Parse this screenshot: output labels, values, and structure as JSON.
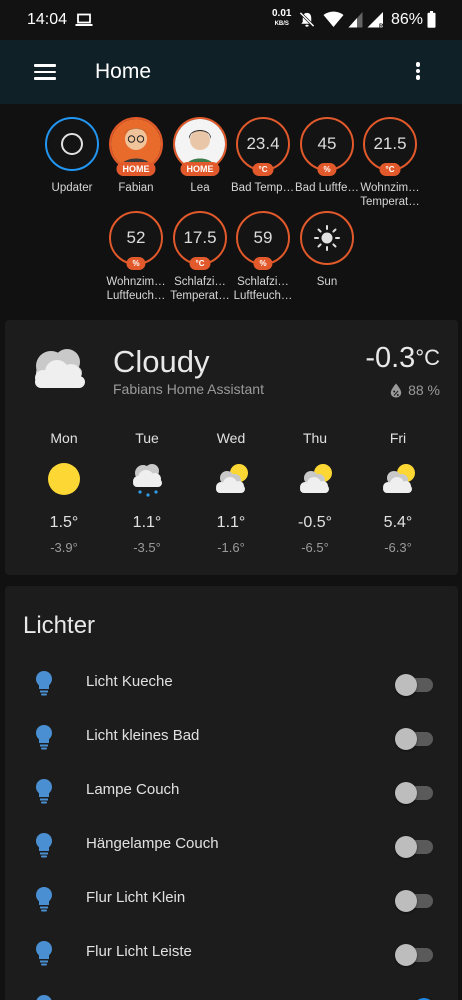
{
  "status_bar": {
    "time": "14:04",
    "net_speed": "0.01",
    "net_unit": "KB/S",
    "battery": "86%"
  },
  "app_bar": {
    "title": "Home",
    "menu_icon": "hamburger-menu-icon",
    "overflow_icon": "more-vert-icon"
  },
  "badges": [
    {
      "label": "Updater",
      "type": "icon",
      "icon": "circle-outline-icon",
      "color": "#2196f3"
    },
    {
      "label": "Fabian",
      "type": "person",
      "tag": "HOME"
    },
    {
      "label": "Lea",
      "type": "person",
      "tag": "HOME"
    },
    {
      "label": "Bad Temperat…",
      "type": "value",
      "value": "23.4",
      "unit": "°C"
    },
    {
      "label": "Bad Luftfeuch…",
      "type": "value",
      "value": "45",
      "unit": "%"
    },
    {
      "label": "Wohnzim… Temperat…",
      "type": "value",
      "value": "21.5",
      "unit": "°C"
    },
    {
      "label": "Wohnzim… Luftfeuch…",
      "type": "value",
      "value": "52",
      "unit": "%"
    },
    {
      "label": "Schlafzi… Temperat…",
      "type": "value",
      "value": "17.5",
      "unit": "°C"
    },
    {
      "label": "Schlafzi… Luftfeuch…",
      "type": "value",
      "value": "59",
      "unit": "%"
    },
    {
      "label": "Sun",
      "type": "icon",
      "icon": "sun-icon"
    }
  ],
  "weather": {
    "condition": "Cloudy",
    "source": "Fabians Home Assistant",
    "temperature": "-0.3",
    "temp_unit": "°C",
    "humidity": "88 %",
    "forecast": [
      {
        "day": "Mon",
        "icon": "sunny-icon",
        "high": "1.5°",
        "low": "-3.9°"
      },
      {
        "day": "Tue",
        "icon": "snowy-icon",
        "high": "1.1°",
        "low": "-3.5°"
      },
      {
        "day": "Wed",
        "icon": "partly-cloudy-icon",
        "high": "1.1°",
        "low": "-1.6°"
      },
      {
        "day": "Thu",
        "icon": "partly-cloudy-icon",
        "high": "-0.5°",
        "low": "-6.5°"
      },
      {
        "day": "Fri",
        "icon": "partly-cloudy-icon",
        "high": "5.4°",
        "low": "-6.3°"
      }
    ]
  },
  "lights": {
    "title": "Lichter",
    "items": [
      {
        "label": "Licht Kueche",
        "on": false
      },
      {
        "label": "Licht kleines Bad",
        "on": false
      },
      {
        "label": "Lampe Couch",
        "on": false
      },
      {
        "label": "Hängelampe Couch",
        "on": false
      },
      {
        "label": "Flur Licht Klein",
        "on": false
      },
      {
        "label": "Flur Licht Leiste",
        "on": false
      },
      {
        "label": "",
        "on": true
      }
    ]
  },
  "colors": {
    "accent": "#e25a2b",
    "app_bar": "#0f2027",
    "light_icon": "#4a8fd1",
    "toggle_on": "#1e88e5"
  }
}
